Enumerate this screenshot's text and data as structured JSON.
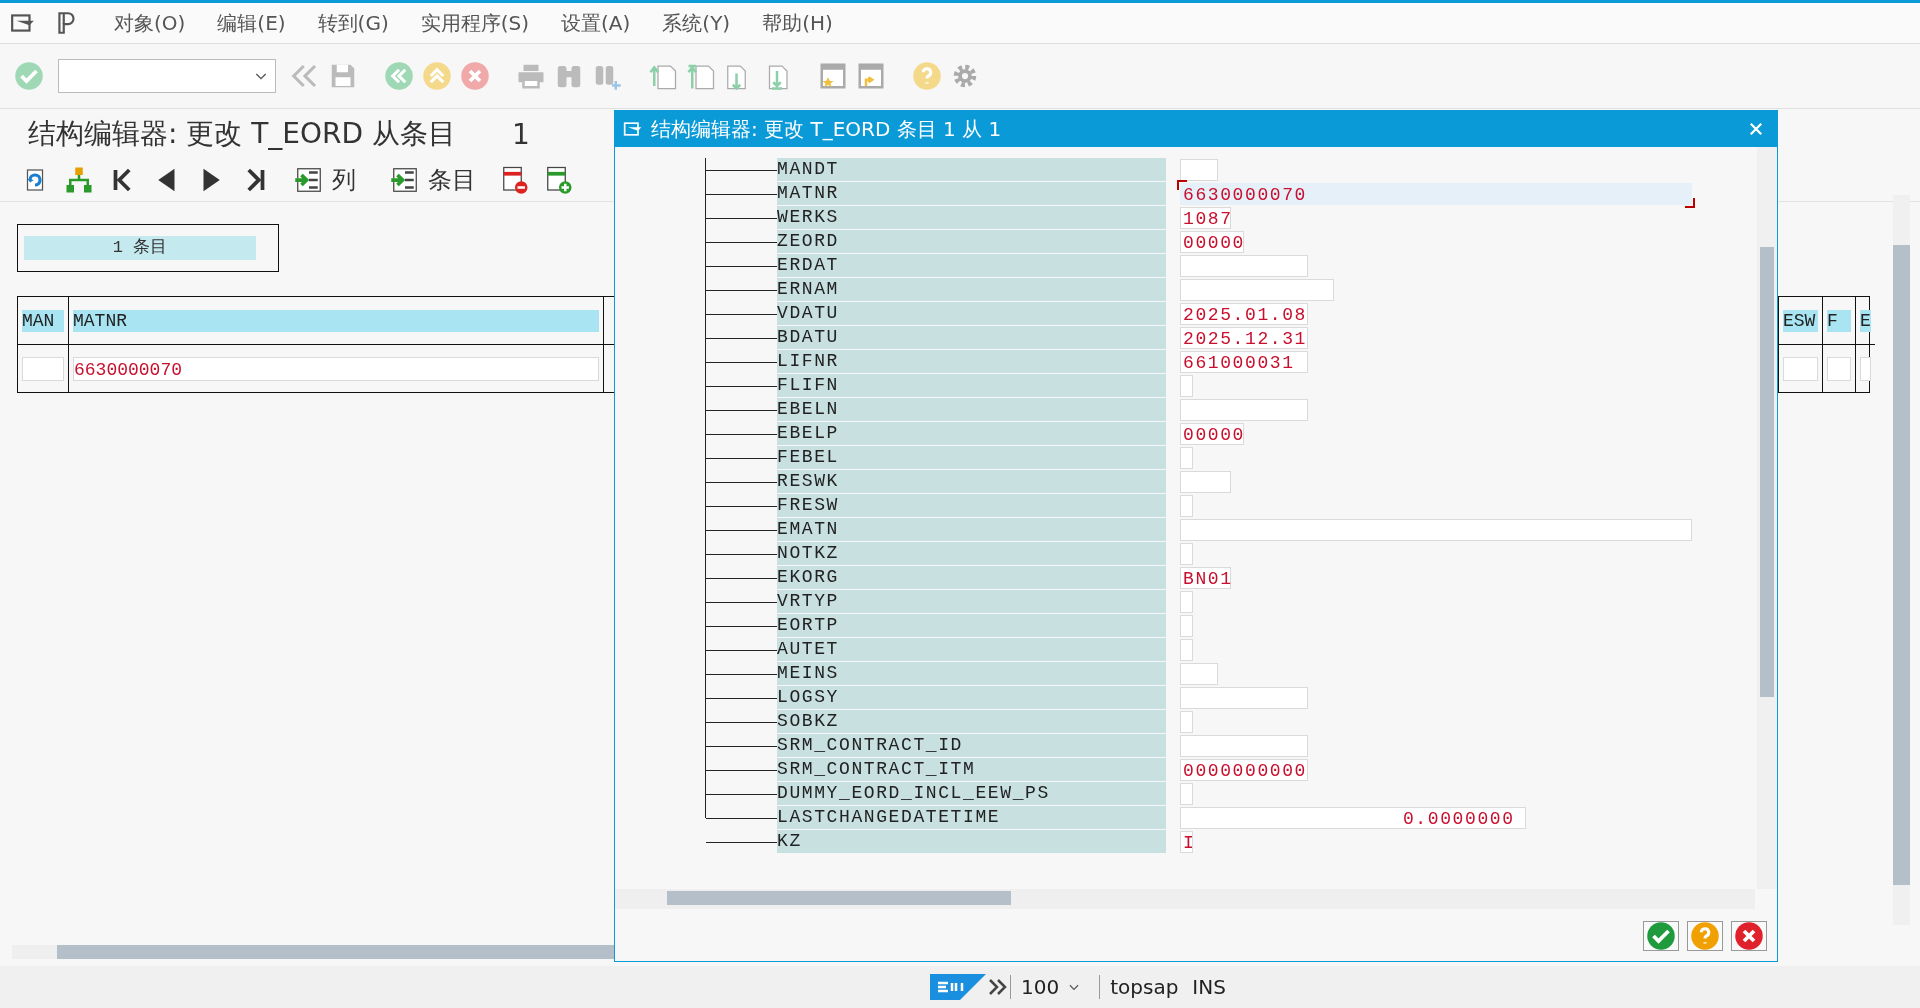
{
  "menu_bar": {
    "items": [
      {
        "label": "对象(O)"
      },
      {
        "label": "编辑(E)"
      },
      {
        "label": "转到(G)"
      },
      {
        "label": "实用程序(S)"
      },
      {
        "label": "设置(A)"
      },
      {
        "label": "系统(Y)"
      },
      {
        "label": "帮助(H)"
      }
    ]
  },
  "screen_title": {
    "text": "结构编辑器: 更改 T_EORD 从条目",
    "tail": "1"
  },
  "app_toolbar": {
    "buttons": [
      {
        "kind": "text",
        "label": "列"
      },
      {
        "kind": "text",
        "label": "条目"
      }
    ]
  },
  "entry_count": "1 条目",
  "table": {
    "columns": [
      {
        "label": "MAN"
      },
      {
        "label": "MATNR"
      },
      {
        "label": "ESW"
      },
      {
        "label": "F"
      },
      {
        "label": "E"
      }
    ],
    "rows": [
      {
        "matnr": "6630000070"
      }
    ]
  },
  "dialog": {
    "title": "结构编辑器: 更改 T_EORD 条目 1 从 1",
    "fields": [
      {
        "name": "MANDT",
        "focused": false
      },
      {
        "name": "MATNR",
        "value": "6630000070",
        "focused": true
      },
      {
        "name": "WERKS",
        "value": "1087",
        "focused": false
      },
      {
        "name": "ZEORD",
        "value": "00000",
        "focused": false
      },
      {
        "name": "ERDAT",
        "focused": false
      },
      {
        "name": "ERNAM",
        "focused": false
      },
      {
        "name": "VDATU",
        "value": "2025.01.08",
        "focused": false
      },
      {
        "name": "BDATU",
        "value": "2025.12.31",
        "focused": false
      },
      {
        "name": "LIFNR",
        "value": "661000031",
        "focused": false
      },
      {
        "name": "FLIFN",
        "focused": false
      },
      {
        "name": "EBELN",
        "focused": false
      },
      {
        "name": "EBELP",
        "value": "00000",
        "focused": false
      },
      {
        "name": "FEBEL",
        "focused": false
      },
      {
        "name": "RESWK",
        "focused": false
      },
      {
        "name": "FRESW",
        "focused": false
      },
      {
        "name": "EMATN",
        "focused": false
      },
      {
        "name": "NOTKZ",
        "focused": false
      },
      {
        "name": "EKORG",
        "value": "BN01",
        "focused": false
      },
      {
        "name": "VRTYP",
        "focused": false
      },
      {
        "name": "EORTP",
        "focused": false
      },
      {
        "name": "AUTET",
        "focused": false
      },
      {
        "name": "MEINS",
        "focused": false
      },
      {
        "name": "LOGSY",
        "focused": false
      },
      {
        "name": "SOBKZ",
        "focused": false
      },
      {
        "name": "SRM_CONTRACT_ID",
        "focused": false
      },
      {
        "name": "SRM_CONTRACT_ITM",
        "value": "0000000000",
        "focused": false
      },
      {
        "name": "DUMMY_EORD_INCL_EEW_PS",
        "focused": false
      },
      {
        "name": "LASTCHANGEDATETIME",
        "value": "0.0000000",
        "kind": "number",
        "focused": false
      },
      {
        "name": "KZ",
        "value": "I",
        "focused": false
      }
    ]
  },
  "status_bar": {
    "zoom": "100",
    "system": "topsap",
    "mode": "INS"
  }
}
